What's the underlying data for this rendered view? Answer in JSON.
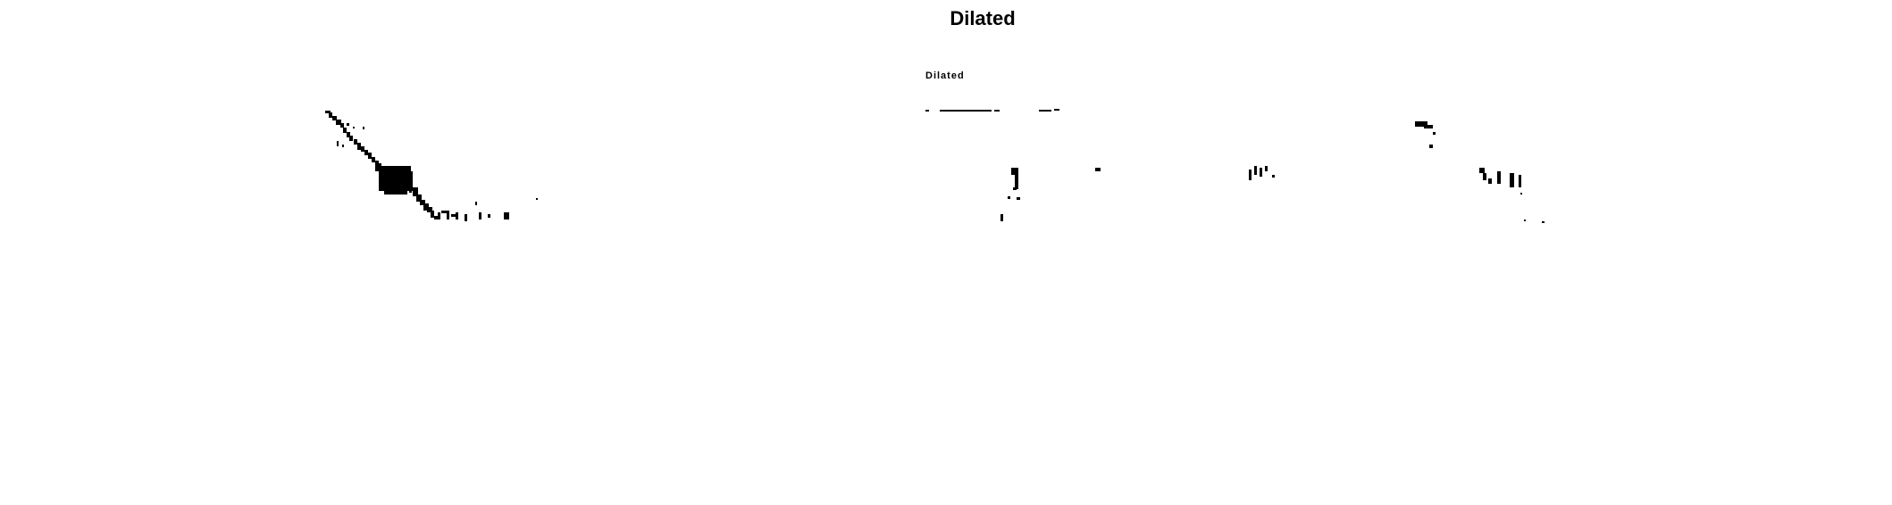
{
  "figure": {
    "title": "Dilated",
    "inner_label": "Dilated",
    "colors": {
      "background": "#ffffff",
      "foreground": "#000000"
    }
  }
}
